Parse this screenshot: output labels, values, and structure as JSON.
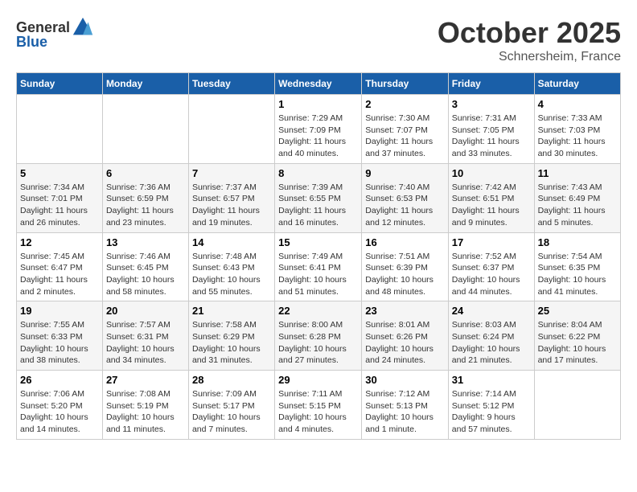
{
  "header": {
    "logo_general": "General",
    "logo_blue": "Blue",
    "month": "October 2025",
    "location": "Schnersheim, France"
  },
  "weekdays": [
    "Sunday",
    "Monday",
    "Tuesday",
    "Wednesday",
    "Thursday",
    "Friday",
    "Saturday"
  ],
  "weeks": [
    [
      {
        "day": "",
        "info": ""
      },
      {
        "day": "",
        "info": ""
      },
      {
        "day": "",
        "info": ""
      },
      {
        "day": "1",
        "info": "Sunrise: 7:29 AM\nSunset: 7:09 PM\nDaylight: 11 hours and 40 minutes."
      },
      {
        "day": "2",
        "info": "Sunrise: 7:30 AM\nSunset: 7:07 PM\nDaylight: 11 hours and 37 minutes."
      },
      {
        "day": "3",
        "info": "Sunrise: 7:31 AM\nSunset: 7:05 PM\nDaylight: 11 hours and 33 minutes."
      },
      {
        "day": "4",
        "info": "Sunrise: 7:33 AM\nSunset: 7:03 PM\nDaylight: 11 hours and 30 minutes."
      }
    ],
    [
      {
        "day": "5",
        "info": "Sunrise: 7:34 AM\nSunset: 7:01 PM\nDaylight: 11 hours and 26 minutes."
      },
      {
        "day": "6",
        "info": "Sunrise: 7:36 AM\nSunset: 6:59 PM\nDaylight: 11 hours and 23 minutes."
      },
      {
        "day": "7",
        "info": "Sunrise: 7:37 AM\nSunset: 6:57 PM\nDaylight: 11 hours and 19 minutes."
      },
      {
        "day": "8",
        "info": "Sunrise: 7:39 AM\nSunset: 6:55 PM\nDaylight: 11 hours and 16 minutes."
      },
      {
        "day": "9",
        "info": "Sunrise: 7:40 AM\nSunset: 6:53 PM\nDaylight: 11 hours and 12 minutes."
      },
      {
        "day": "10",
        "info": "Sunrise: 7:42 AM\nSunset: 6:51 PM\nDaylight: 11 hours and 9 minutes."
      },
      {
        "day": "11",
        "info": "Sunrise: 7:43 AM\nSunset: 6:49 PM\nDaylight: 11 hours and 5 minutes."
      }
    ],
    [
      {
        "day": "12",
        "info": "Sunrise: 7:45 AM\nSunset: 6:47 PM\nDaylight: 11 hours and 2 minutes."
      },
      {
        "day": "13",
        "info": "Sunrise: 7:46 AM\nSunset: 6:45 PM\nDaylight: 10 hours and 58 minutes."
      },
      {
        "day": "14",
        "info": "Sunrise: 7:48 AM\nSunset: 6:43 PM\nDaylight: 10 hours and 55 minutes."
      },
      {
        "day": "15",
        "info": "Sunrise: 7:49 AM\nSunset: 6:41 PM\nDaylight: 10 hours and 51 minutes."
      },
      {
        "day": "16",
        "info": "Sunrise: 7:51 AM\nSunset: 6:39 PM\nDaylight: 10 hours and 48 minutes."
      },
      {
        "day": "17",
        "info": "Sunrise: 7:52 AM\nSunset: 6:37 PM\nDaylight: 10 hours and 44 minutes."
      },
      {
        "day": "18",
        "info": "Sunrise: 7:54 AM\nSunset: 6:35 PM\nDaylight: 10 hours and 41 minutes."
      }
    ],
    [
      {
        "day": "19",
        "info": "Sunrise: 7:55 AM\nSunset: 6:33 PM\nDaylight: 10 hours and 38 minutes."
      },
      {
        "day": "20",
        "info": "Sunrise: 7:57 AM\nSunset: 6:31 PM\nDaylight: 10 hours and 34 minutes."
      },
      {
        "day": "21",
        "info": "Sunrise: 7:58 AM\nSunset: 6:29 PM\nDaylight: 10 hours and 31 minutes."
      },
      {
        "day": "22",
        "info": "Sunrise: 8:00 AM\nSunset: 6:28 PM\nDaylight: 10 hours and 27 minutes."
      },
      {
        "day": "23",
        "info": "Sunrise: 8:01 AM\nSunset: 6:26 PM\nDaylight: 10 hours and 24 minutes."
      },
      {
        "day": "24",
        "info": "Sunrise: 8:03 AM\nSunset: 6:24 PM\nDaylight: 10 hours and 21 minutes."
      },
      {
        "day": "25",
        "info": "Sunrise: 8:04 AM\nSunset: 6:22 PM\nDaylight: 10 hours and 17 minutes."
      }
    ],
    [
      {
        "day": "26",
        "info": "Sunrise: 7:06 AM\nSunset: 5:20 PM\nDaylight: 10 hours and 14 minutes."
      },
      {
        "day": "27",
        "info": "Sunrise: 7:08 AM\nSunset: 5:19 PM\nDaylight: 10 hours and 11 minutes."
      },
      {
        "day": "28",
        "info": "Sunrise: 7:09 AM\nSunset: 5:17 PM\nDaylight: 10 hours and 7 minutes."
      },
      {
        "day": "29",
        "info": "Sunrise: 7:11 AM\nSunset: 5:15 PM\nDaylight: 10 hours and 4 minutes."
      },
      {
        "day": "30",
        "info": "Sunrise: 7:12 AM\nSunset: 5:13 PM\nDaylight: 10 hours and 1 minute."
      },
      {
        "day": "31",
        "info": "Sunrise: 7:14 AM\nSunset: 5:12 PM\nDaylight: 9 hours and 57 minutes."
      },
      {
        "day": "",
        "info": ""
      }
    ]
  ]
}
